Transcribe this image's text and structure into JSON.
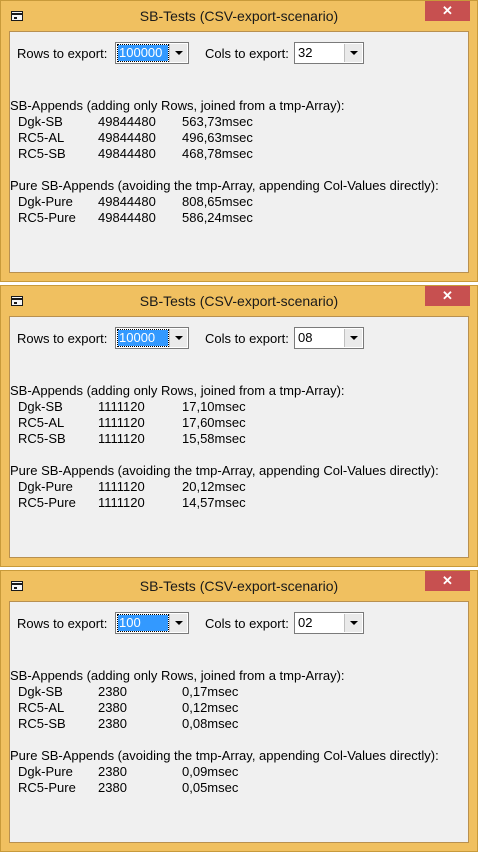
{
  "windows": [
    {
      "title": "SB-Tests (CSV-export-scenario)",
      "close_glyph": "✕",
      "rows_label": "Rows to export:",
      "rows_value": "100000",
      "cols_label": "Cols to export:",
      "cols_value": "32",
      "section1_title": "SB-Appends (adding only Rows, joined from a tmp-Array):",
      "section1_rows": [
        {
          "name": "Dgk-SB",
          "count": "49844480",
          "time": "563,73msec"
        },
        {
          "name": "RC5-AL",
          "count": "49844480",
          "time": "496,63msec"
        },
        {
          "name": "RC5-SB",
          "count": "49844480",
          "time": "468,78msec"
        }
      ],
      "section2_title": "Pure SB-Appends (avoiding the tmp-Array, appending Col-Values directly):",
      "section2_rows": [
        {
          "name": "Dgk-Pure",
          "count": "49844480",
          "time": "808,65msec"
        },
        {
          "name": "RC5-Pure",
          "count": "49844480",
          "time": "586,24msec"
        }
      ]
    },
    {
      "title": "SB-Tests (CSV-export-scenario)",
      "close_glyph": "✕",
      "rows_label": "Rows to export:",
      "rows_value": "10000",
      "cols_label": "Cols to export:",
      "cols_value": "08",
      "section1_title": "SB-Appends (adding only Rows, joined from a tmp-Array):",
      "section1_rows": [
        {
          "name": "Dgk-SB",
          "count": "1111120",
          "time": "17,10msec"
        },
        {
          "name": "RC5-AL",
          "count": "1111120",
          "time": "17,60msec"
        },
        {
          "name": "RC5-SB",
          "count": "1111120",
          "time": "15,58msec"
        }
      ],
      "section2_title": "Pure SB-Appends (avoiding the tmp-Array, appending Col-Values directly):",
      "section2_rows": [
        {
          "name": "Dgk-Pure",
          "count": "1111120",
          "time": "20,12msec"
        },
        {
          "name": "RC5-Pure",
          "count": "1111120",
          "time": "14,57msec"
        }
      ]
    },
    {
      "title": "SB-Tests (CSV-export-scenario)",
      "close_glyph": "✕",
      "rows_label": "Rows to export:",
      "rows_value": "100",
      "cols_label": "Cols to export:",
      "cols_value": "02",
      "section1_title": "SB-Appends (adding only Rows, joined from a tmp-Array):",
      "section1_rows": [
        {
          "name": "Dgk-SB",
          "count": "2380",
          "time": "0,17msec"
        },
        {
          "name": "RC5-AL",
          "count": "2380",
          "time": "0,12msec"
        },
        {
          "name": "RC5-SB",
          "count": "2380",
          "time": "0,08msec"
        }
      ],
      "section2_title": "Pure SB-Appends (avoiding the tmp-Array, appending Col-Values directly):",
      "section2_rows": [
        {
          "name": "Dgk-Pure",
          "count": "2380",
          "time": "0,09msec"
        },
        {
          "name": "RC5-Pure",
          "count": "2380",
          "time": "0,05msec"
        }
      ]
    }
  ]
}
